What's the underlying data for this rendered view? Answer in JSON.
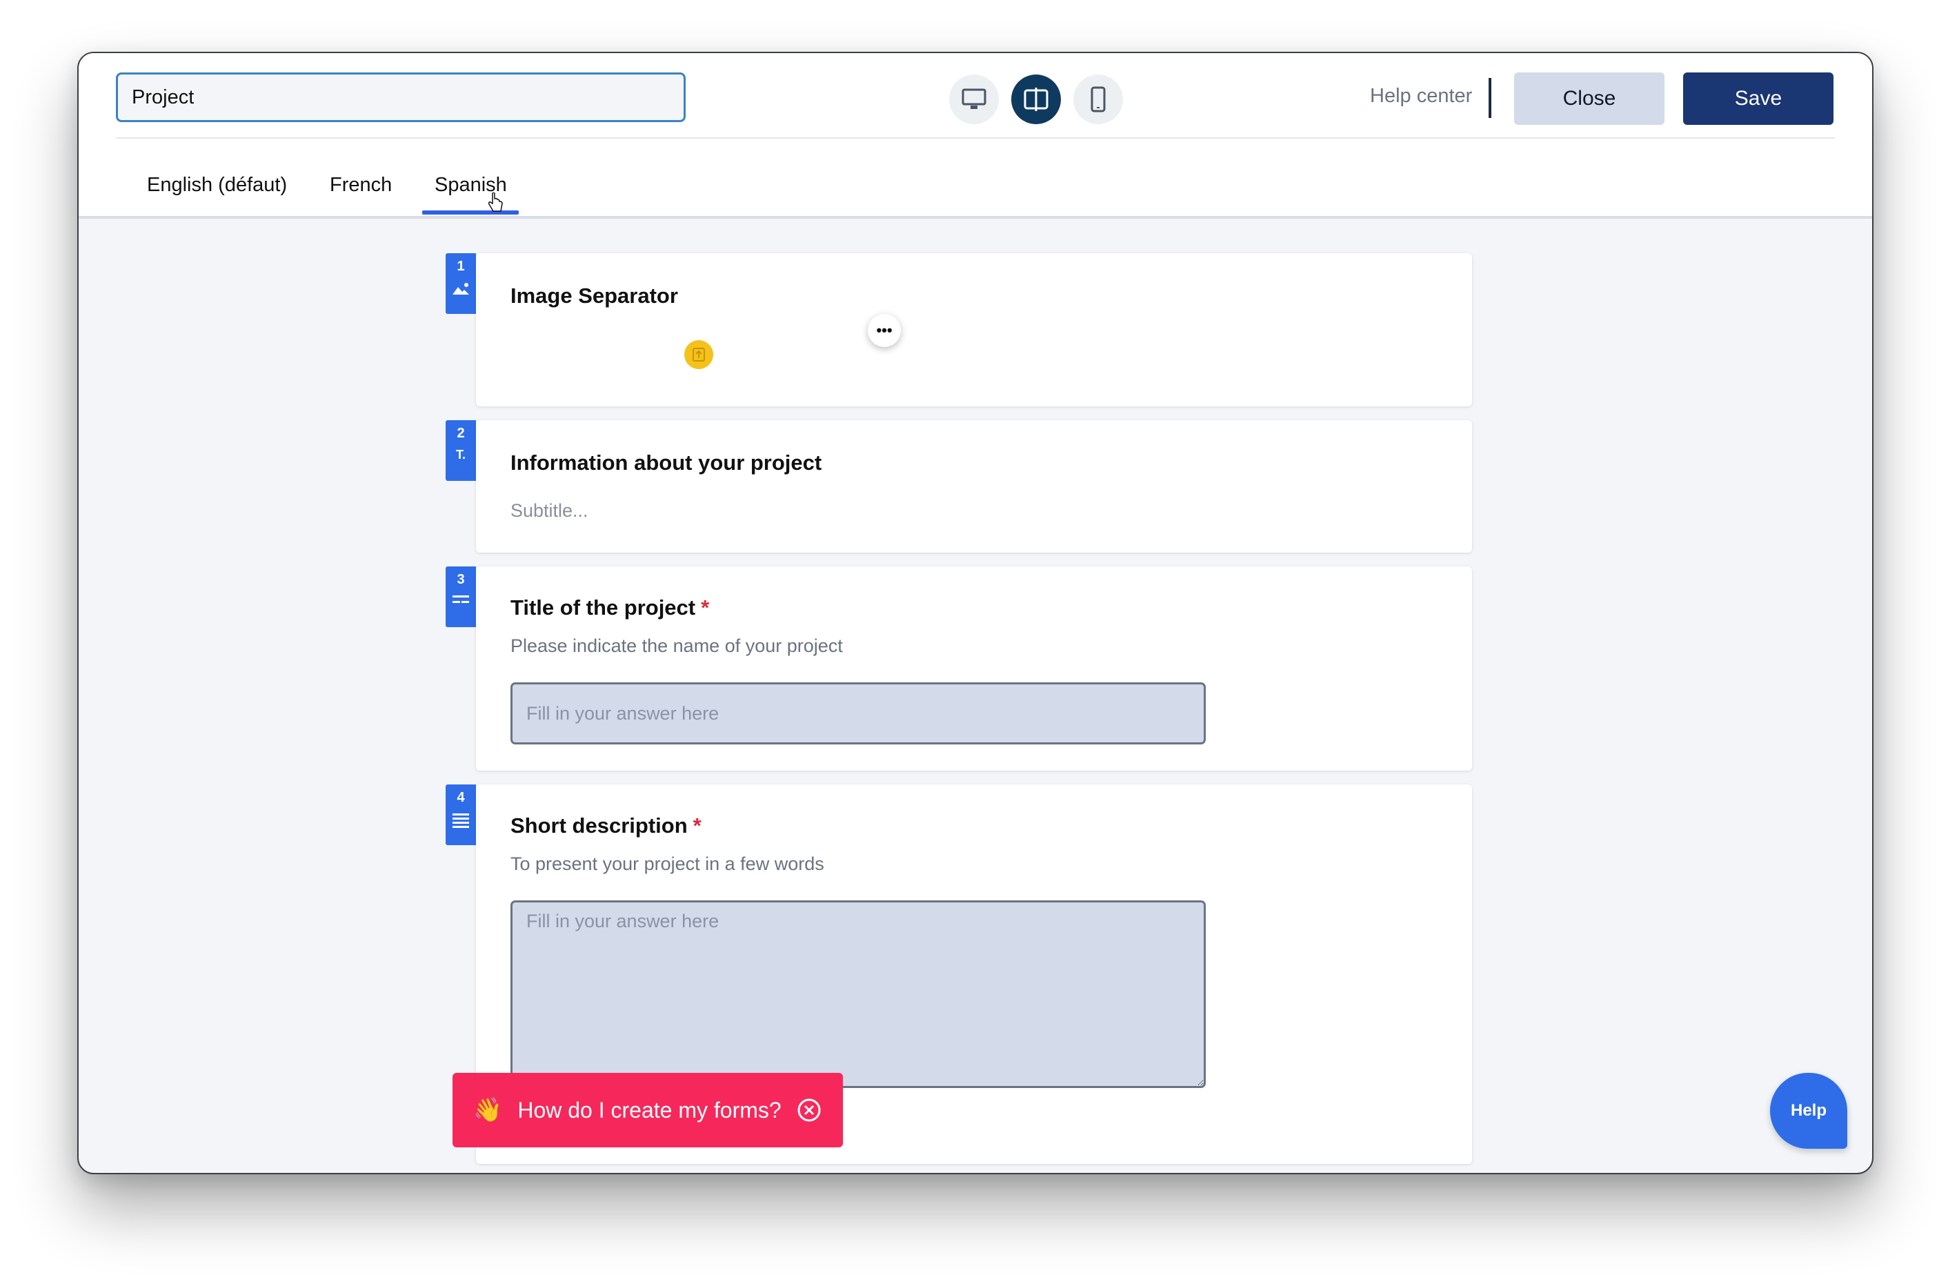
{
  "header": {
    "form_title_value": "Project",
    "view_modes": [
      "desktop-icon",
      "split-view-icon",
      "mobile-icon"
    ],
    "active_view": "split-view-icon",
    "help_center_label": "Help center",
    "close_label": "Close",
    "save_label": "Save"
  },
  "tabs": {
    "items": [
      "English (défaut)",
      "French",
      "Spanish"
    ],
    "active": "Spanish"
  },
  "questions": [
    {
      "number": "1",
      "type_icon": "image-icon",
      "title": "Image Separator"
    },
    {
      "number": "2",
      "type_icon": "text-icon",
      "icon_text": "T.",
      "title": "Information about your project",
      "subtitle_placeholder": "Subtitle..."
    },
    {
      "number": "3",
      "type_icon": "short-answer-icon",
      "title": "Title of the project",
      "required": "*",
      "description": "Please indicate the name of your project",
      "answer_placeholder": "Fill in your answer here"
    },
    {
      "number": "4",
      "type_icon": "paragraph-icon",
      "title": "Short description",
      "required": "*",
      "description": "To present your project in a few words",
      "answer_placeholder": "Fill in your answer here"
    }
  ],
  "toast": {
    "emoji": "👋",
    "text": "How do I create my forms?"
  },
  "help_bubble": {
    "label": "Help"
  },
  "colors": {
    "accent": "#2f6de8",
    "primary_dark": "#1a3673",
    "toast": "#f6285b",
    "required": "#e0283c"
  }
}
